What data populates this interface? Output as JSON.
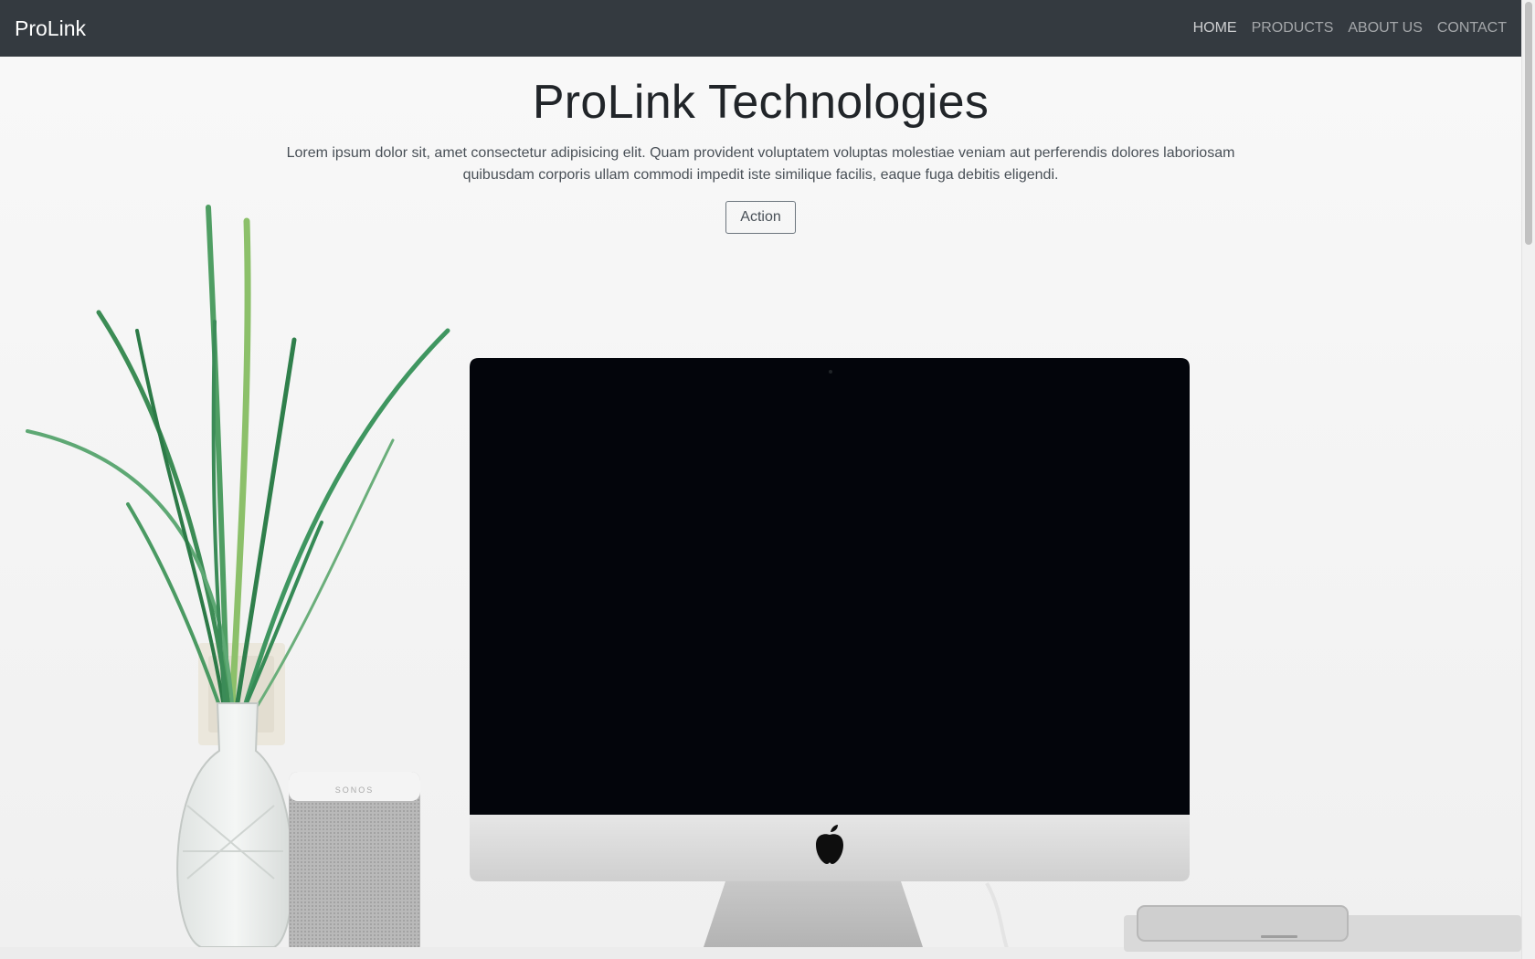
{
  "navbar": {
    "brand": "ProLink",
    "items": [
      {
        "label": "HOME"
      },
      {
        "label": "PRODUCTS"
      },
      {
        "label": "ABOUT US"
      },
      {
        "label": "CONTACT"
      }
    ]
  },
  "hero": {
    "title": "ProLink Technologies",
    "text": "Lorem ipsum dolor sit, amet consectetur adipisicing elit. Quam provident voluptatem voluptas molestiae veniam aut perferendis dolores laboriosam quibusdam corporis ullam commodi impedit iste similique facilis, eaque fuga debitis eligendi.",
    "button_label": "Action",
    "speaker_label": "SONOS"
  }
}
